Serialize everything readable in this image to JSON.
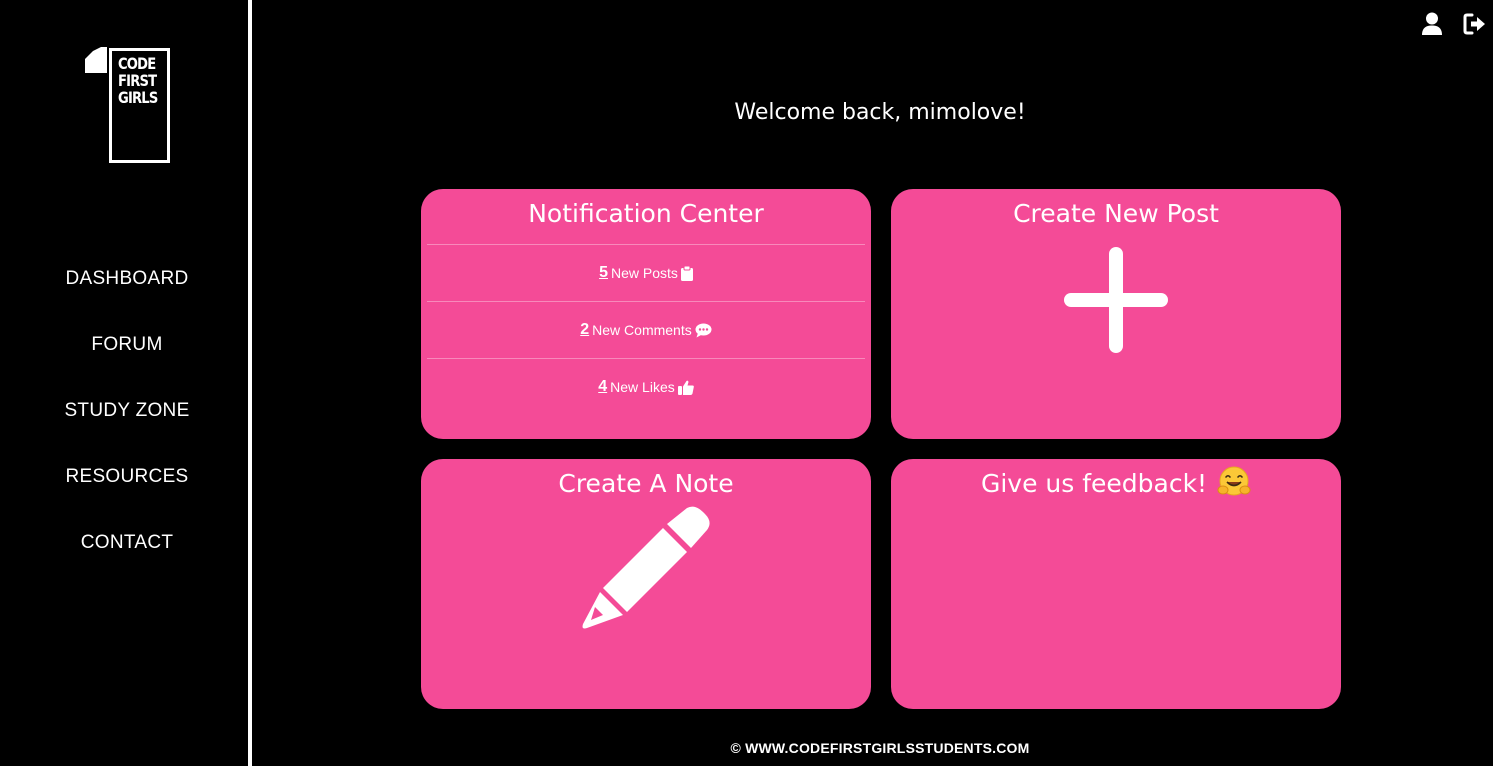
{
  "brand": {
    "logo_lines": [
      "CODE",
      "FIRST",
      "GIRLS"
    ],
    "accent_color": "#f44b97"
  },
  "nav": {
    "items": [
      {
        "label": "DASHBOARD"
      },
      {
        "label": "FORUM"
      },
      {
        "label": "STUDY ZONE"
      },
      {
        "label": "RESOURCES"
      },
      {
        "label": "CONTACT"
      }
    ]
  },
  "header": {
    "icons": [
      "user-icon",
      "logout-icon"
    ]
  },
  "main": {
    "welcome": "Welcome back, mimolove!",
    "cards": {
      "notifications": {
        "title": "Notification Center",
        "rows": [
          {
            "count": "5",
            "label": "New Posts",
            "icon": "clipboard-icon"
          },
          {
            "count": "2",
            "label": "New Comments",
            "icon": "comment-icon"
          },
          {
            "count": "4",
            "label": "New Likes",
            "icon": "thumbs-up-icon"
          }
        ]
      },
      "new_post": {
        "title": "Create New Post",
        "icon": "plus-icon"
      },
      "note": {
        "title": "Create A Note",
        "icon": "pencil-icon"
      },
      "feedback": {
        "title": "Give us feedback!",
        "icon": "hugging-face-emoji"
      }
    }
  },
  "footer": {
    "text": "© WWW.CODEFIRSTGIRLSSTUDENTS.COM"
  }
}
